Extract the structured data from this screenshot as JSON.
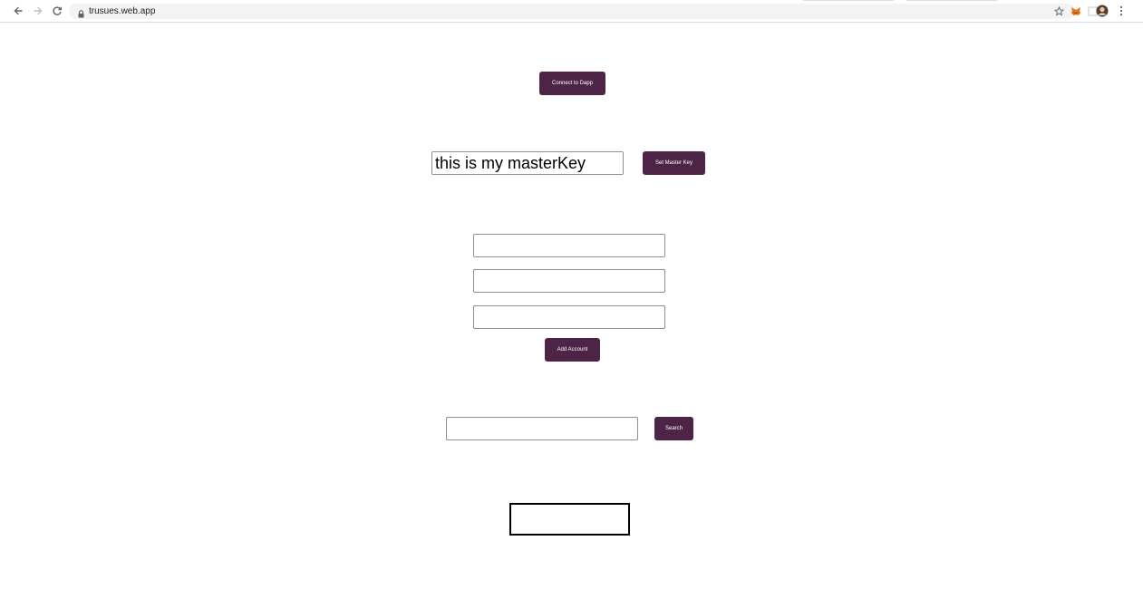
{
  "browser": {
    "url": "trusues.web.app",
    "icons": {
      "back": "back-arrow-icon",
      "forward": "forward-arrow-icon",
      "reload": "reload-icon",
      "lock": "lock-icon",
      "star": "bookmark-star-icon",
      "metamask": "metamask-fox-icon",
      "extension": "extension-icon",
      "profile": "profile-avatar-icon",
      "menu": "kebab-menu-icon"
    }
  },
  "app": {
    "connect_label": "Connect to Dapp",
    "master_key_value": "this is my masterKey",
    "set_master_key_label": "Set Master Key",
    "account_field_1_value": "",
    "account_field_2_value": "",
    "account_field_3_value": "",
    "add_account_label": "Add Account",
    "search_value": "",
    "search_label": "Search",
    "result_text": ""
  },
  "colors": {
    "button_bg": "#4d2446",
    "button_text": "#ffffff",
    "field_border": "#8f8f8f"
  }
}
